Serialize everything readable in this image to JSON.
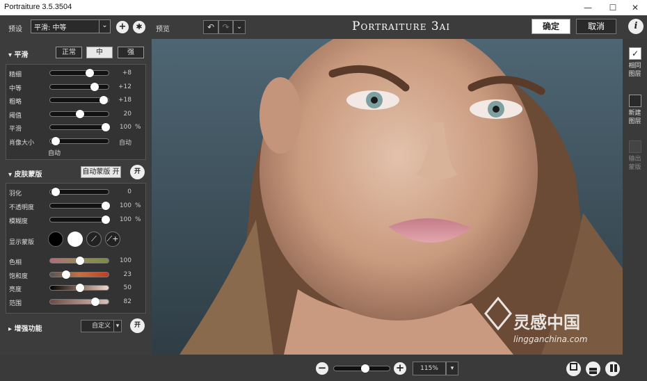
{
  "window": {
    "title": "Portraiture 3.5.3504",
    "minimize": "—",
    "maximize": "☐",
    "close": "✕"
  },
  "toolbar": {
    "preset_label": "预设",
    "preset_value": "平滑: 中等",
    "preview_label": "预览",
    "brand": "Portraiture 3ai",
    "ok": "确定",
    "cancel": "取消",
    "info": "i",
    "undo_icon": "undo-icon",
    "redo_icon": "redo-icon"
  },
  "smooth": {
    "title": "平滑",
    "modes": [
      "正常",
      "中",
      "强"
    ],
    "active_mode": 1,
    "sliders": [
      {
        "label": "精细",
        "value": "+8",
        "unit": "",
        "level": 0.68
      },
      {
        "label": "中等",
        "value": "+12",
        "unit": "",
        "level": 0.76
      },
      {
        "label": "粗略",
        "value": "+18",
        "unit": "",
        "level": 0.92
      },
      {
        "label": "阈值",
        "value": "20",
        "unit": "",
        "level": 0.5
      },
      {
        "label": "平滑",
        "value": "100",
        "unit": "%",
        "level": 0.96
      },
      {
        "label": "肖像大小",
        "value": "自动",
        "unit": "",
        "level": 0.06
      }
    ],
    "size_note": "自动"
  },
  "skin": {
    "title": "皮肤蒙版",
    "auto_mask": "自动蒙版 开",
    "toggle": "开",
    "sliders": [
      {
        "label": "羽化",
        "value": "0",
        "unit": "",
        "level": 0.06
      },
      {
        "label": "不透明度",
        "value": "100",
        "unit": "%",
        "level": 0.96
      },
      {
        "label": "模糊度",
        "value": "100",
        "unit": "%",
        "level": 0.96
      }
    ],
    "show_mask": "显示蒙版",
    "color_sliders": [
      {
        "label": "色相",
        "value": "100",
        "level": 0.5
      },
      {
        "label": "饱和度",
        "value": "23",
        "level": 0.25
      },
      {
        "label": "亮度",
        "value": "50",
        "level": 0.5
      },
      {
        "label": "范围",
        "value": "82",
        "level": 0.78
      }
    ]
  },
  "enhance": {
    "title": "增强功能",
    "custom": "自定义",
    "toggle": "开"
  },
  "right": {
    "same_layer": "相同\n图层",
    "new_layer": "新建\n图层",
    "output_mask": "输出\n蒙版"
  },
  "bottom": {
    "zoom": "115%",
    "zoom_level": 0.55,
    "minus": "−",
    "plus": "+"
  },
  "watermark": {
    "name": "灵感中国",
    "url": "lingganchina.com"
  }
}
